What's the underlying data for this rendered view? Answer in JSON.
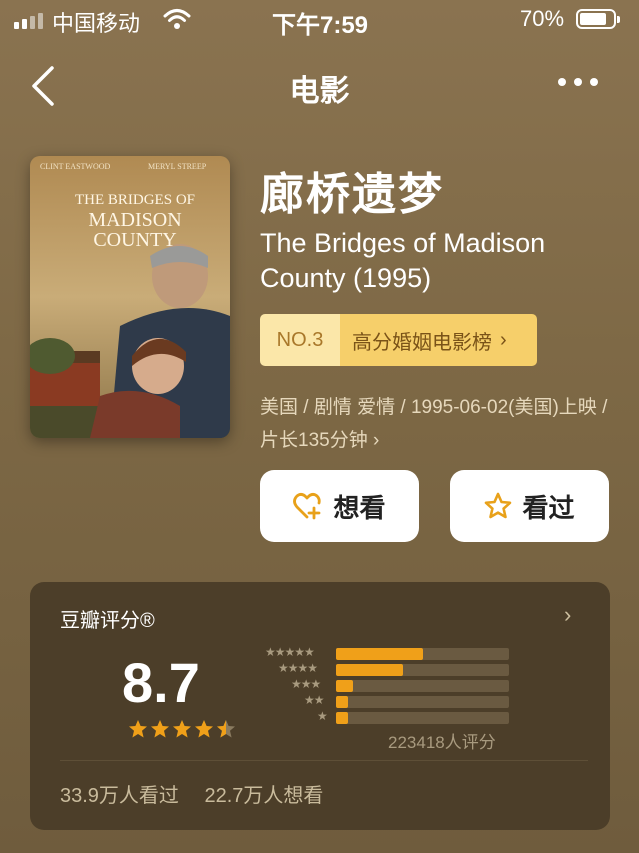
{
  "status_bar": {
    "carrier": "中国移动",
    "time": "下午7:59",
    "battery_percent": "70%"
  },
  "nav": {
    "title": "电影"
  },
  "movie": {
    "poster": {
      "actor_left": "CLINT EASTWOOD",
      "actor_right": "MERYL STREEP",
      "title_line1": "THE BRIDGES OF",
      "title_line2": "MADISON",
      "title_line3": "COUNTY"
    },
    "title_cn": "廊桥遗梦",
    "title_en": "The Bridges of Madison County (1995)",
    "rank_no": "NO.3",
    "rank_list": "高分婚姻电影榜",
    "meta": "美国 / 剧情 爱情 / 1995-06-02(美国)上映 / 片长135分钟 ›"
  },
  "actions": {
    "want_label": "想看",
    "seen_label": "看过"
  },
  "rating": {
    "title": "豆瓣评分®",
    "score": "8.7",
    "stars": 4.5,
    "distribution": [
      {
        "stars": 5,
        "fraction": 0.5
      },
      {
        "stars": 4,
        "fraction": 0.39
      },
      {
        "stars": 3,
        "fraction": 0.1
      },
      {
        "stars": 2,
        "fraction": 0.07
      },
      {
        "stars": 1,
        "fraction": 0.07
      }
    ],
    "count": "223418人评分",
    "watched": "33.9万人看过",
    "wish": "22.7万人想看"
  },
  "colors": {
    "background": "#7d6845",
    "card": "#4c3e29",
    "accent_orange": "#f0a019",
    "rank_light": "#fbe7a9",
    "rank_dark": "#f6cf6a"
  }
}
